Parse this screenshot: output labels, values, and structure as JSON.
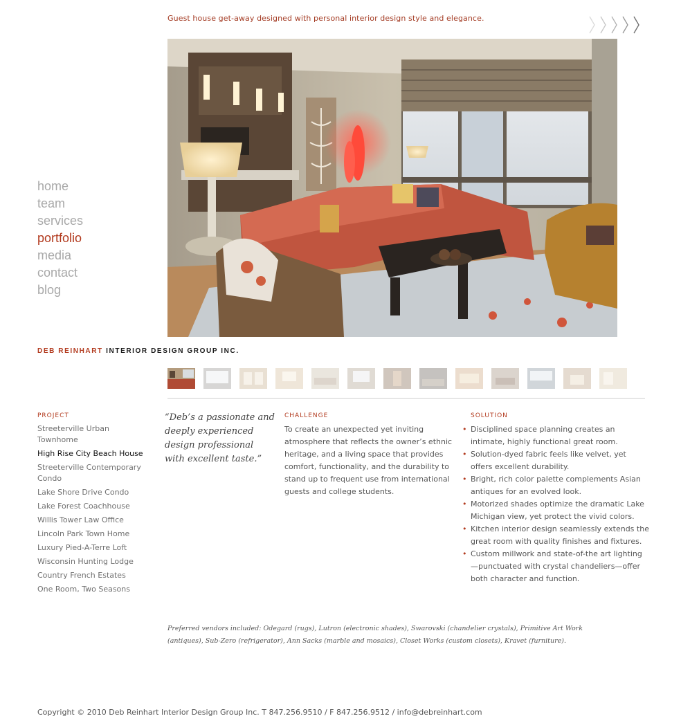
{
  "tagline": "Guest house get-away designed with personal interior design style and elegance.",
  "nav": [
    {
      "label": "home",
      "active": false
    },
    {
      "label": "team",
      "active": false
    },
    {
      "label": "services",
      "active": false
    },
    {
      "label": "portfolio",
      "active": true
    },
    {
      "label": "media",
      "active": false
    },
    {
      "label": "contact",
      "active": false
    },
    {
      "label": "blog",
      "active": false
    }
  ],
  "brand": {
    "name_red": "DEB REINHART",
    "name_dark": "INTERIOR DESIGN GROUP INC."
  },
  "project_label": "PROJECT",
  "projects": [
    "Streeterville Urban Townhome",
    "High Rise City Beach House",
    "Streeterville Contemporary Condo",
    "Lake Shore Drive Condo",
    "Lake Forest Coachhouse",
    "Willis Tower Law Office",
    "Lincoln Park Town Home",
    "Luxury Pied-A-Terre Loft",
    "Wisconsin Hunting Lodge",
    "Country French Estates",
    "One Room, Two Seasons"
  ],
  "current_project_index": 1,
  "quote": "“Deb’s a passionate and deeply experienced design professional with excellent taste.”",
  "challenge_label": "CHALLENGE",
  "challenge_text": "To create an unexpected yet inviting atmosphere that reflects the owner’s ethnic heritage, and a living space that provides comfort, functionality, and the durability to stand up to frequent use from international guests and college students.",
  "solution_label": "SOLUTION",
  "solutions": [
    "Disciplined space planning creates an intimate, highly functional great room.",
    "Solution-dyed fabric feels like velvet, yet offers excellent durability.",
    "Bright, rich color palette complements Asian antiques for an evolved look.",
    "Motorized shades optimize the dramatic Lake Michigan view, yet protect the vivid colors.",
    "Kitchen interior design seamlessly extends the great room with quality finishes and fixtures.",
    "Custom millwork and state-of-the art lighting—punctuated with crystal chandeliers—offer both character and function."
  ],
  "vendors": "Preferred vendors included: Odegard (rugs), Lutron (electronic shades), Swarovski (chandelier crystals), Primitive Art Work (antiques), Sub-Zero (refrigerator), Ann Sacks (marble and mosaics), Closet Works (custom closets), Kravet (furniture).",
  "footer": "Copyright © 2010 Deb Reinhart Interior Design Group Inc. T 847.256.9510 / F 847.256.9512 / info@debreinhart.com",
  "thumbnails": [
    {
      "name": "thumbnail-1",
      "active": true
    },
    {
      "name": "thumbnail-2",
      "active": false
    },
    {
      "name": "thumbnail-3",
      "active": false
    },
    {
      "name": "thumbnail-4",
      "active": false
    },
    {
      "name": "thumbnail-5",
      "active": false
    },
    {
      "name": "thumbnail-6",
      "active": false
    },
    {
      "name": "thumbnail-7",
      "active": false
    },
    {
      "name": "thumbnail-8",
      "active": false
    },
    {
      "name": "thumbnail-9",
      "active": false
    },
    {
      "name": "thumbnail-10",
      "active": false
    },
    {
      "name": "thumbnail-11",
      "active": false
    },
    {
      "name": "thumbnail-12",
      "active": false
    },
    {
      "name": "thumbnail-13",
      "active": false
    }
  ],
  "colors": {
    "accent": "#b23a1e",
    "nav_inactive": "#a8a8a8",
    "rule": "#cfcfcf"
  },
  "icons": [
    "chevron-right-icon"
  ]
}
